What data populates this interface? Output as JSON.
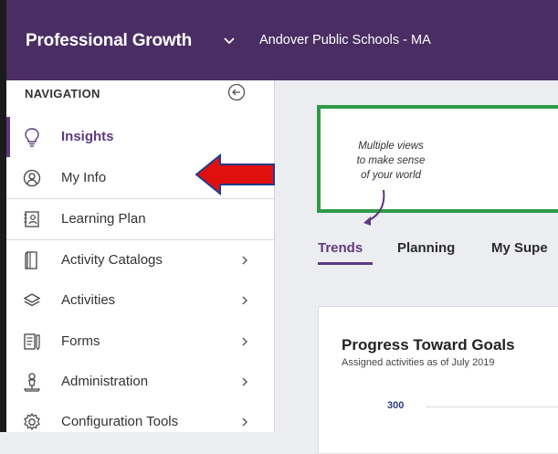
{
  "header": {
    "app_title": "Professional Growth",
    "org_name": "Andover Public Schools - MA"
  },
  "sidebar": {
    "title": "NAVIGATION",
    "items": [
      {
        "label": "Insights",
        "icon": "lightbulb-icon",
        "active": true
      },
      {
        "label": "My Info",
        "icon": "person-circle-icon"
      },
      {
        "label": "Learning Plan",
        "icon": "portfolio-icon"
      },
      {
        "label": "Activity Catalogs",
        "icon": "book-icon",
        "has_submenu": true
      },
      {
        "label": "Activities",
        "icon": "layers-icon",
        "has_submenu": true
      },
      {
        "label": "Forms",
        "icon": "form-icon",
        "has_submenu": true
      },
      {
        "label": "Administration",
        "icon": "admin-person-icon",
        "has_submenu": true
      },
      {
        "label": "Configuration Tools",
        "icon": "gear-icon",
        "has_submenu": true
      }
    ]
  },
  "callout": {
    "lines": [
      "Multiple views",
      "to make sense",
      "of your world"
    ]
  },
  "tabs": [
    {
      "label": "Trends",
      "active": true
    },
    {
      "label": "Planning"
    },
    {
      "label": "My Supe"
    }
  ],
  "card": {
    "title": "Progress Toward Goals",
    "subtitle": "Assigned activities as of July 2019",
    "axis_value": "300"
  },
  "colors": {
    "header_bg": "#4a2d63",
    "accent": "#5e3a80",
    "callout_border": "#2e9a47",
    "arrow_red": "#e01010",
    "arrow_outline": "#1f3d8a"
  }
}
